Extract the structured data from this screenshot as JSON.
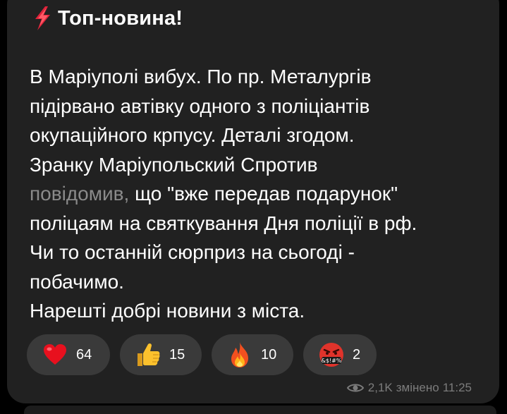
{
  "post": {
    "title": "Топ-новина!",
    "title_icon": "lightning-icon",
    "lines": [
      "В Маріуполі вибух. По пр. Металургів",
      "підірвано автівку одного з поліціантів",
      "окупаційного крпусу. Деталі згодом.",
      "Зранку Маріупольский Спротив"
    ],
    "link_text": "повідомив,",
    "link_line_rest": " що \"вже передав подарунок\"",
    "lines_after": [
      "поліцаям на святкування Дня поліції в рф.",
      "Чи то останній сюрприз на сьогоді -",
      "побачимо.",
      "Нарешті добрі новини з міста."
    ]
  },
  "reactions": [
    {
      "icon": "heart-icon",
      "count": "64"
    },
    {
      "icon": "thumbs-up-icon",
      "count": "15"
    },
    {
      "icon": "fire-icon",
      "count": "10"
    },
    {
      "icon": "cursing-face-icon",
      "count": "2"
    }
  ],
  "meta": {
    "views": "2,1K",
    "edited_label": "змінено",
    "time": "11:25"
  },
  "colors": {
    "background": "#000000",
    "bubble": "#212121",
    "reaction_bg": "#3a3a3a",
    "link": "#8a8a8a",
    "meta": "#7c7c7c"
  }
}
